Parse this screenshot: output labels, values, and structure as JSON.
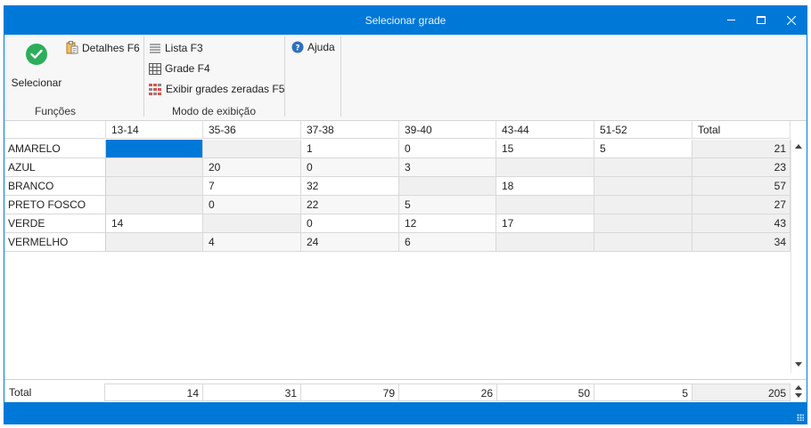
{
  "window": {
    "title": "Selecionar grade"
  },
  "ribbon": {
    "funcoes": {
      "label": "Funções",
      "selecionar": "Selecionar",
      "detalhes": "Detalhes F6"
    },
    "modo": {
      "label": "Modo de exibição",
      "lista": "Lista F3",
      "grade": "Grade F4",
      "zeradas": "Exibir grades zeradas F5"
    },
    "ajuda": {
      "label": "Ajuda"
    }
  },
  "grid": {
    "columns": [
      "13-14",
      "35-36",
      "37-38",
      "39-40",
      "43-44",
      "51-52",
      "Total"
    ],
    "rows": [
      {
        "label": "AMARELO",
        "cells": [
          "",
          "",
          "1",
          "0",
          "15",
          "5"
        ],
        "total": "21"
      },
      {
        "label": "AZUL",
        "cells": [
          "",
          "20",
          "0",
          "3",
          "",
          ""
        ],
        "total": "23"
      },
      {
        "label": "BRANCO",
        "cells": [
          "",
          "7",
          "32",
          "",
          "18",
          ""
        ],
        "total": "57"
      },
      {
        "label": "PRETO FOSCO",
        "cells": [
          "",
          "0",
          "22",
          "5",
          "",
          ""
        ],
        "total": "27"
      },
      {
        "label": "VERDE",
        "cells": [
          "14",
          "",
          "0",
          "12",
          "17",
          ""
        ],
        "total": "43"
      },
      {
        "label": "VERMELHO",
        "cells": [
          "",
          "4",
          "24",
          "6",
          "",
          ""
        ],
        "total": "34"
      }
    ]
  },
  "footer": {
    "label": "Total",
    "values": [
      "14",
      "31",
      "79",
      "26",
      "50",
      "5"
    ],
    "grand_total": "205"
  },
  "colors": {
    "accent": "#0078d7",
    "check": "#2cae5a",
    "help": "#2f6fbf"
  }
}
